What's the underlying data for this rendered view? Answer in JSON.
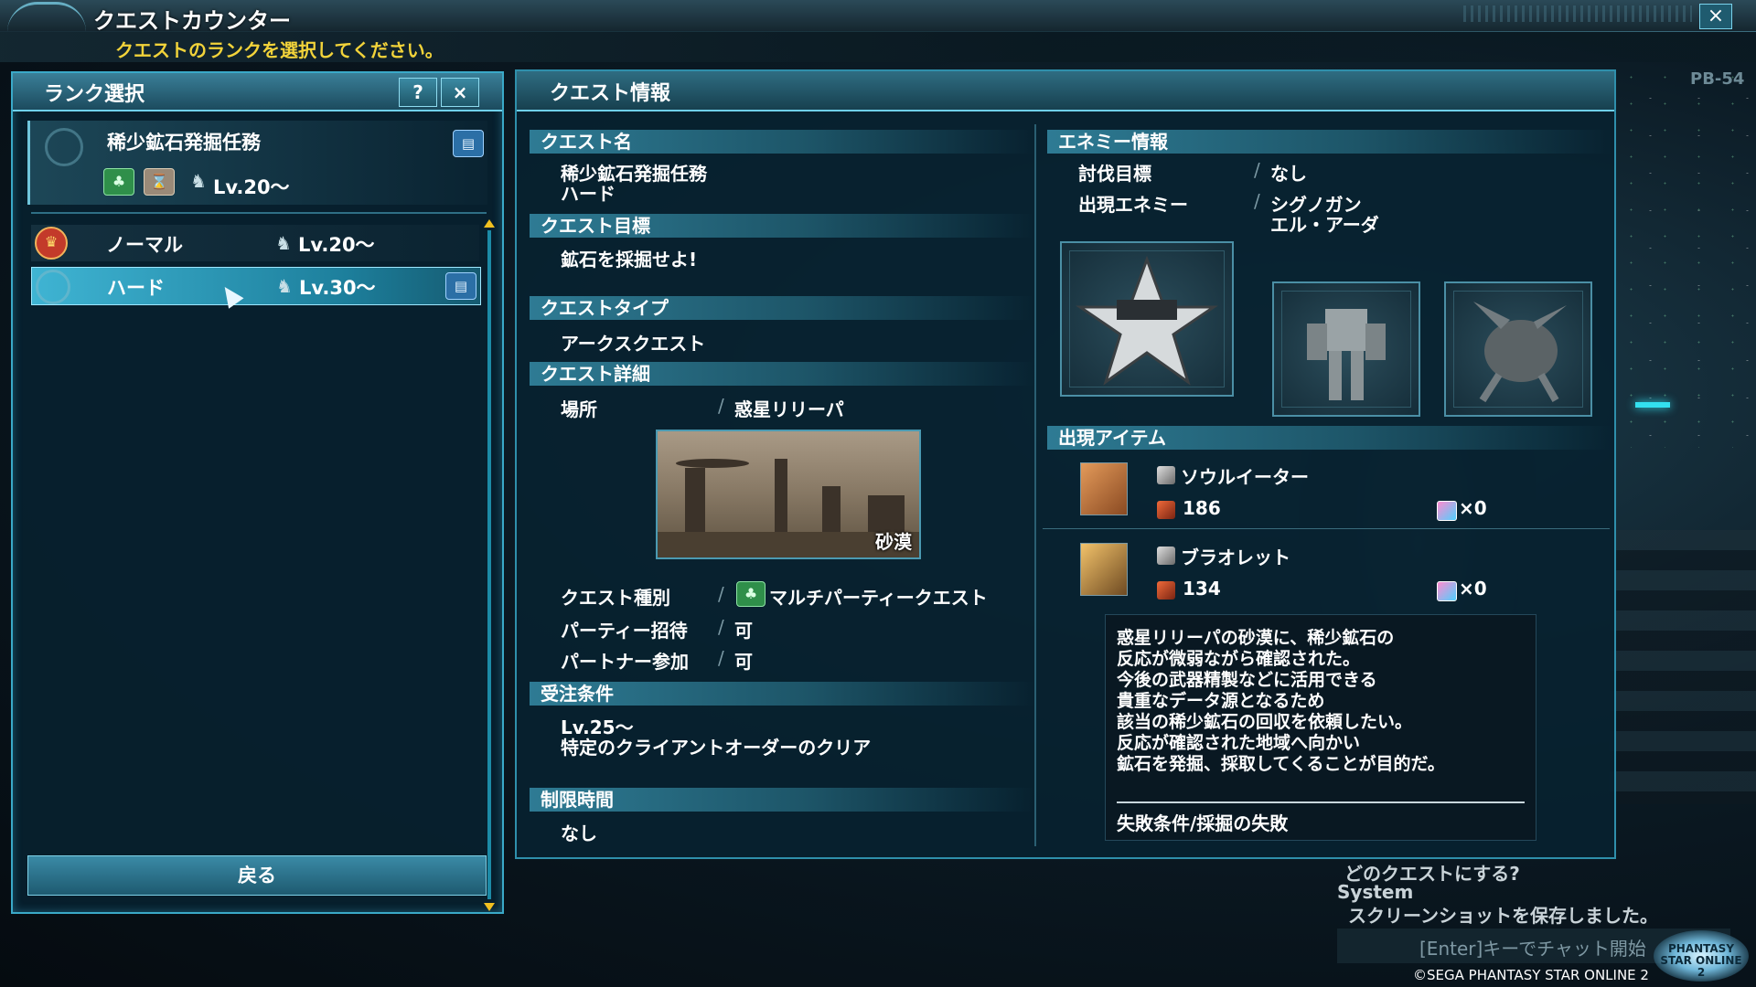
{
  "window": {
    "title": "クエストカウンター",
    "instruction": "クエストのランクを選択してください。",
    "screen_code": "PB-54",
    "close_icon": "×"
  },
  "rank_panel": {
    "title": "ランク選択",
    "help_icon": "?",
    "close_icon": "×",
    "selected_quest": {
      "name": "稀少鉱石発掘任務",
      "level": "Lv.20〜"
    },
    "ranks": [
      {
        "label": "ノーマル",
        "level": "Lv.20〜"
      },
      {
        "label": "ハード",
        "level": "Lv.30〜"
      }
    ],
    "back_button": "戻る"
  },
  "quest_info": {
    "title": "クエスト情報",
    "quest_name": {
      "header": "クエスト名",
      "name": "稀少鉱石発掘任務",
      "rank": "ハード"
    },
    "objective": {
      "header": "クエスト目標",
      "text": "鉱石を採掘せよ!"
    },
    "quest_type": {
      "header": "クエストタイプ",
      "text": "アークスクエスト"
    },
    "details": {
      "header": "クエスト詳細",
      "location_label": "場所",
      "location": "惑星リリーパ",
      "area": "砂漠",
      "kind_label": "クエスト種別",
      "kind": "マルチパーティークエスト",
      "party_invite_label": "パーティー招待",
      "party_invite": "可",
      "partner_label": "パートナー参加",
      "partner": "可"
    },
    "conditions": {
      "header": "受注条件",
      "level": "Lv.25〜",
      "requirement": "特定のクライアントオーダーのクリア"
    },
    "time_limit": {
      "header": "制限時間",
      "value": "なし"
    },
    "enemy_info": {
      "header": "エネミー情報",
      "target_label": "討伐目標",
      "target": "なし",
      "appear_label": "出現エネミー",
      "enemies": [
        "シグノガン",
        "エル・アーダ"
      ]
    },
    "items": {
      "header": "出現アイテム",
      "list": [
        {
          "name": "ソウルイーター",
          "value": "186",
          "count": "×0"
        },
        {
          "name": "ブラオレット",
          "value": "134",
          "count": "×0"
        }
      ]
    },
    "description": [
      "惑星リリーパの砂漠に、稀少鉱石の",
      "反応が微弱ながら確認された。",
      "今後の武器精製などに活用できる",
      "貴重なデータ源となるため",
      "該当の稀少鉱石の回収を依頼したい。",
      "反応が確認された地域へ向かい",
      "鉱石を発掘、採取してくることが目的だ。"
    ],
    "fail_condition": "失敗条件/採掘の失敗"
  },
  "chat": {
    "line1": "どのクエストにする?",
    "line2": "System",
    "line3": "スクリーンショットを保存しました。",
    "hint": "[Enter]キーでチャット開始"
  },
  "logo_text": "PHANTASY STAR ONLINE 2",
  "copyright": "©SEGA PHANTASY STAR ONLINE 2",
  "colors": {
    "accent": "#3fb4d3",
    "instruction": "#f2d33a",
    "panel_bg": "#08222f"
  }
}
